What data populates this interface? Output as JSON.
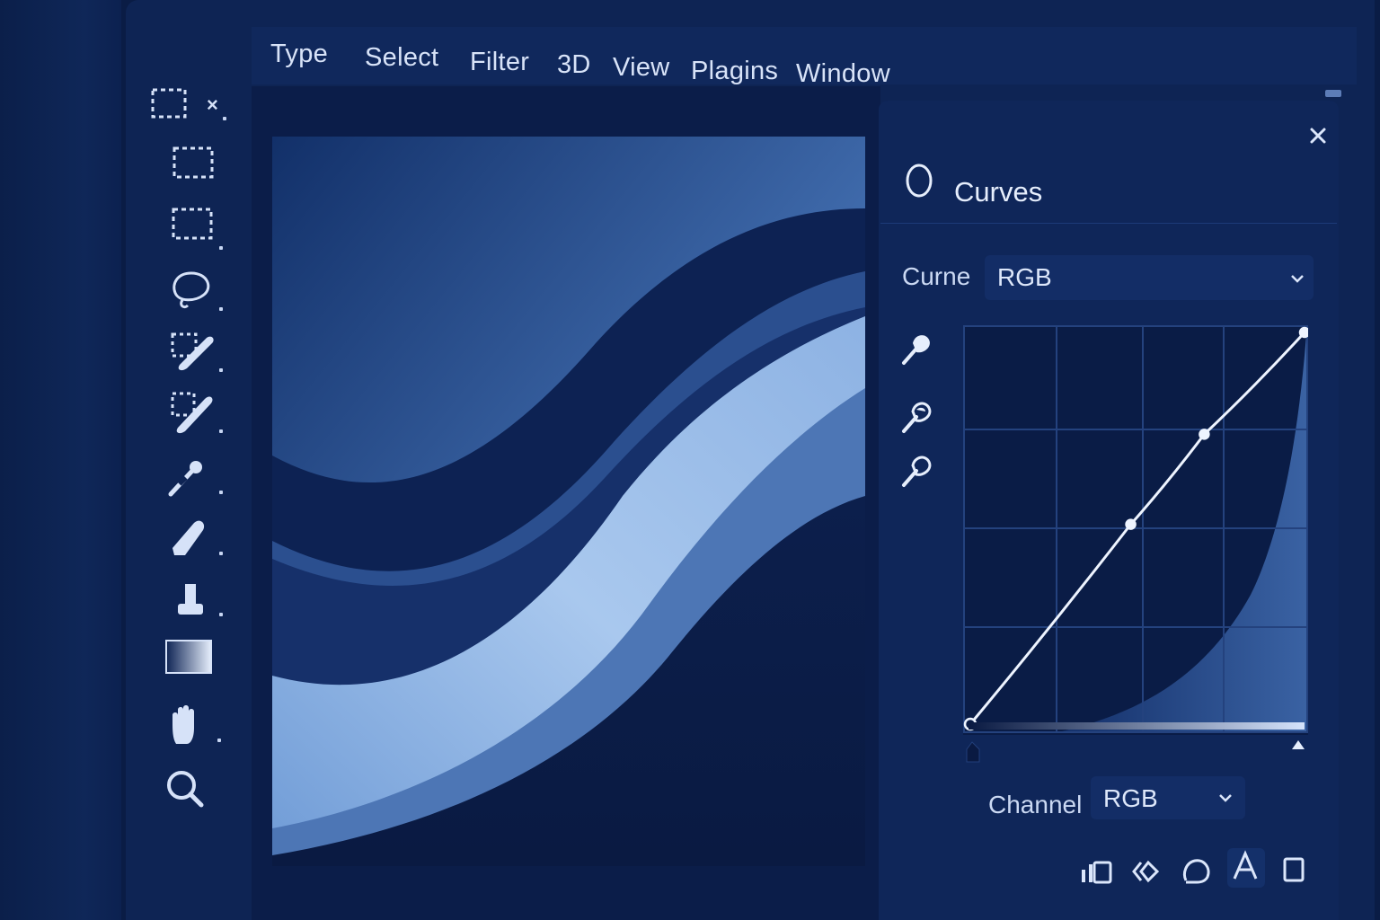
{
  "menubar": {
    "items": [
      "Type",
      "Select",
      "Filter",
      "3D",
      "View",
      "Plagins",
      "Window"
    ]
  },
  "toolbar": {
    "tools": [
      {
        "icon": "marquee-options-icon"
      },
      {
        "icon": "rect-marquee-icon"
      },
      {
        "icon": "marquee-alt-icon"
      },
      {
        "icon": "lasso-icon"
      },
      {
        "icon": "quick-selection-icon"
      },
      {
        "icon": "magic-wand-icon"
      },
      {
        "icon": "eyedropper-icon"
      },
      {
        "icon": "eraser-icon"
      },
      {
        "icon": "stamp-icon"
      },
      {
        "icon": "gradient-icon"
      },
      {
        "icon": "hand-icon"
      },
      {
        "icon": "zoom-icon"
      }
    ]
  },
  "panel": {
    "title": "Curves",
    "title_icon": "circle-icon",
    "curve_label": "Curne",
    "curve_value": "RGB",
    "channel_label": "Channel",
    "channel_value": "RGB",
    "eyedroppers": [
      "sample-black-point-icon",
      "sample-gray-point-icon",
      "sample-white-point-icon"
    ],
    "footer_icons": [
      "clip-to-layer-icon",
      "view-previous-icon",
      "reset-icon",
      "visibility-icon",
      "delete-icon"
    ]
  },
  "curve": {
    "points": [
      [
        0,
        0
      ],
      [
        48,
        51
      ],
      [
        70,
        74
      ],
      [
        100,
        100
      ]
    ]
  },
  "colors": {
    "accent": "#cfe0ff",
    "panel_bg": "#0f2659",
    "canvas_bg": "#0b1d49"
  }
}
